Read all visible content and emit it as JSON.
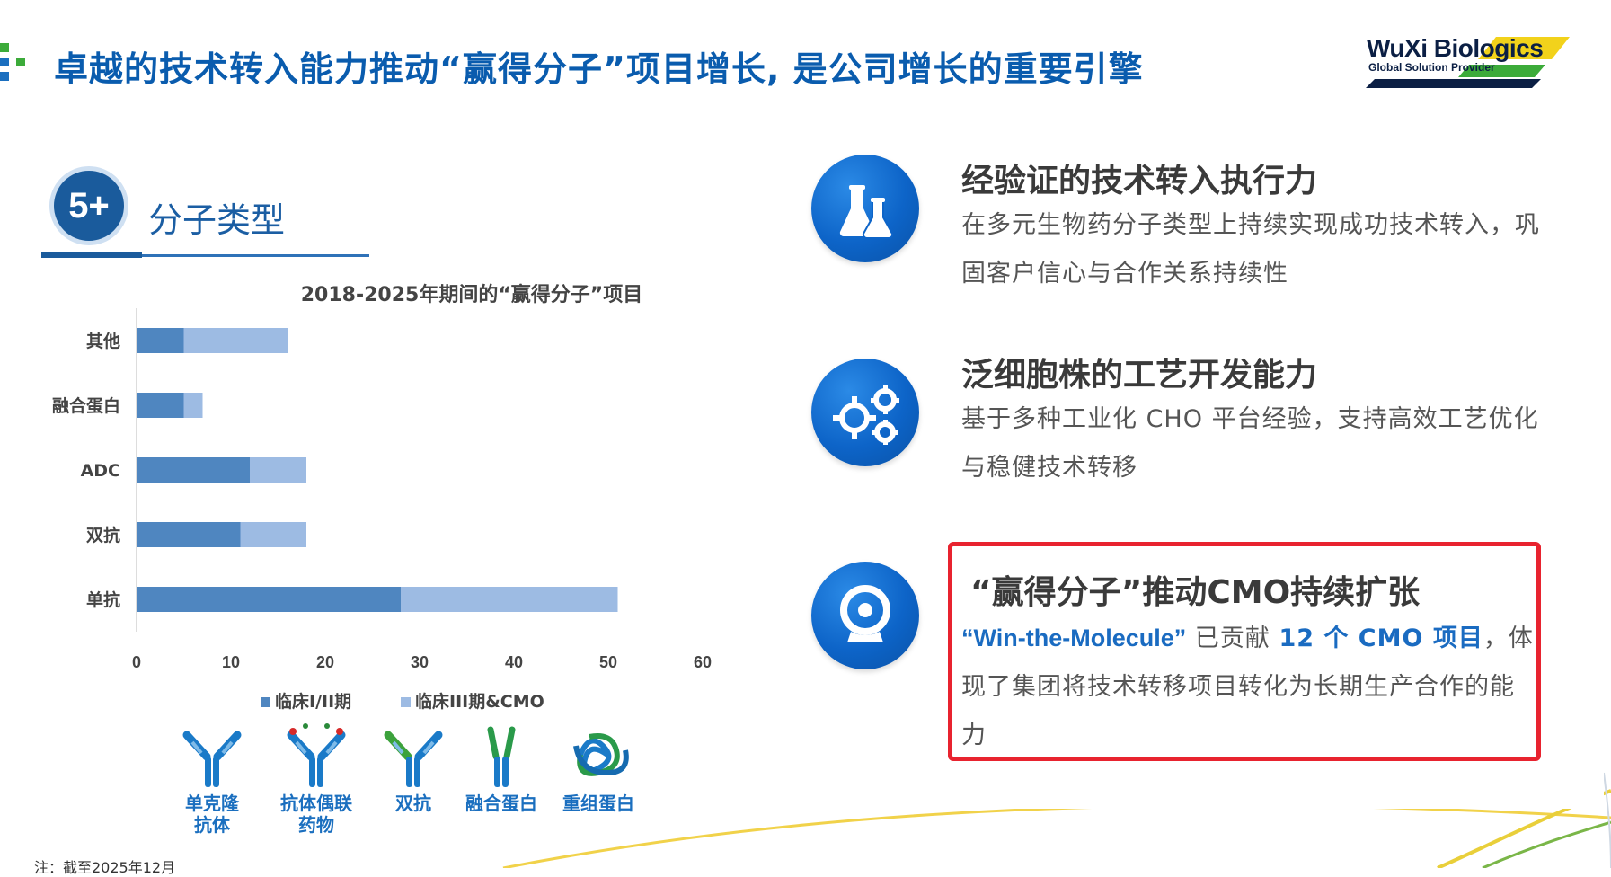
{
  "header": {
    "title": "卓越的技术转入能力推动“赢得分子”项目增长, 是公司增长的重要引擎"
  },
  "logo": {
    "name": "WuXi Biologics",
    "tagline": "Global Solution Provider"
  },
  "section": {
    "badge": "5+",
    "label": "分子类型"
  },
  "colors": {
    "title_blue": "#0a5cae",
    "series_dark": "#4f86c0",
    "series_light": "#9dbbe3",
    "highlight_red": "#e8232f",
    "icon_blue": "#0d64c8"
  },
  "chart_data": {
    "type": "bar",
    "orientation": "horizontal",
    "stacked": true,
    "title": "2018-2025年期间的“赢得分子”项目",
    "categories": [
      "其他",
      "融合蛋白",
      "ADC",
      "双抗",
      "单抗"
    ],
    "series": [
      {
        "name": "临床I/II期",
        "values": [
          5,
          5,
          12,
          11,
          28
        ]
      },
      {
        "name": "临床III期&CMO",
        "values": [
          11,
          2,
          6,
          7,
          23
        ]
      }
    ],
    "xlim": [
      0,
      60
    ],
    "xticks": [
      "0",
      "10",
      "20",
      "30",
      "40",
      "50",
      "60"
    ],
    "grid": false,
    "legend_position": "bottom"
  },
  "molecules": [
    {
      "label_line1": "单克隆",
      "label_line2": "抗体",
      "icon": "antibody-icon"
    },
    {
      "label_line1": "抗体偶联",
      "label_line2": "药物",
      "icon": "adc-icon"
    },
    {
      "label_line1": "双抗",
      "label_line2": "",
      "icon": "bispecific-icon"
    },
    {
      "label_line1": "融合蛋白",
      "label_line2": "",
      "icon": "fusion-protein-icon"
    },
    {
      "label_line1": "重组蛋白",
      "label_line2": "",
      "icon": "recombinant-protein-icon"
    }
  ],
  "features": [
    {
      "icon": "lab-flasks-icon",
      "title": "经验证的技术转入执行力",
      "desc": "在多元生物药分子类型上持续实现成功技术转入，巩固客户信心与合作关系持续性"
    },
    {
      "icon": "gears-icon",
      "title": "泛细胞株的工艺开发能力",
      "desc": "基于多种工业化 CHO 平台经验，支持高效工艺优化与稳健技术转移"
    }
  ],
  "highlight": {
    "icon": "webcam-icon",
    "title": "“赢得分子”推动CMO持续扩张",
    "en_label": "“Win-the-Molecule”",
    "text_part1": " 已贡献 ",
    "count_text": "12 个 CMO 项目",
    "text_part2": "，体现了集团将技术转移项目转化为长期生产合作的能力"
  },
  "footnote": "注：截至2025年12月"
}
